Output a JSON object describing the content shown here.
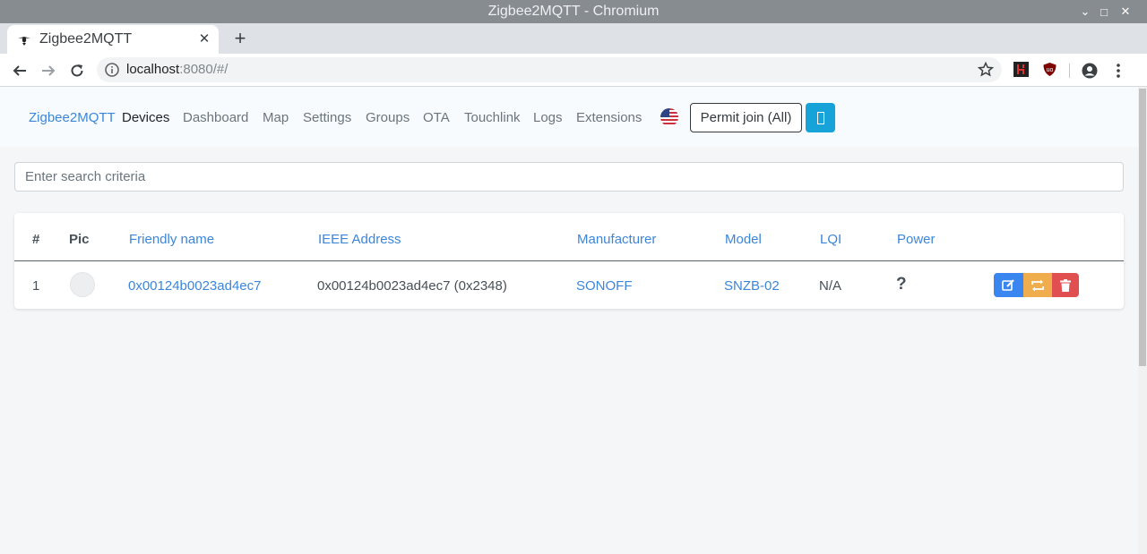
{
  "window": {
    "title": "Zigbee2MQTT - Chromium",
    "controls": {
      "minimize": "⌄",
      "maximize": "□",
      "close": "✕"
    }
  },
  "tab": {
    "title": "Zigbee2MQTT",
    "close": "✕",
    "new_tab": "+"
  },
  "address_bar": {
    "host": "localhost",
    "path": ":8080/#/"
  },
  "navbar": {
    "brand": "Zigbee2MQTT",
    "links": [
      "Devices",
      "Dashboard",
      "Map",
      "Settings",
      "Groups",
      "OTA",
      "Touchlink",
      "Logs",
      "Extensions"
    ],
    "active": "Devices",
    "permit_join": "Permit join (All)"
  },
  "search": {
    "placeholder": "Enter search criteria",
    "value": ""
  },
  "table": {
    "headers": [
      "#",
      "Pic",
      "Friendly name",
      "IEEE Address",
      "Manufacturer",
      "Model",
      "LQI",
      "Power"
    ],
    "rows": [
      {
        "index": "1",
        "friendly_name": "0x00124b0023ad4ec7",
        "ieee_address": "0x00124b0023ad4ec7 (0x2348)",
        "manufacturer": "SONOFF",
        "model": "SNZB-02",
        "lqi": "N/A",
        "power": "?"
      }
    ]
  },
  "colors": {
    "link": "#3c86d9",
    "edit_button": "#3a86f0",
    "swap_button": "#f0ad4e",
    "delete_button": "#e05050",
    "permit_dropdown": "#17a2d8"
  },
  "icons": {
    "tab_favicon": "zigbee-bee-icon",
    "back": "arrow-left-icon",
    "forward": "arrow-right-icon",
    "reload": "reload-icon",
    "site_info": "info-icon",
    "bookmark": "star-icon",
    "profile": "account-circle-icon",
    "menu": "kebab-menu-icon",
    "language": "us-flag-icon",
    "edit": "edit-icon",
    "swap": "swap-icon",
    "delete": "trash-icon"
  }
}
